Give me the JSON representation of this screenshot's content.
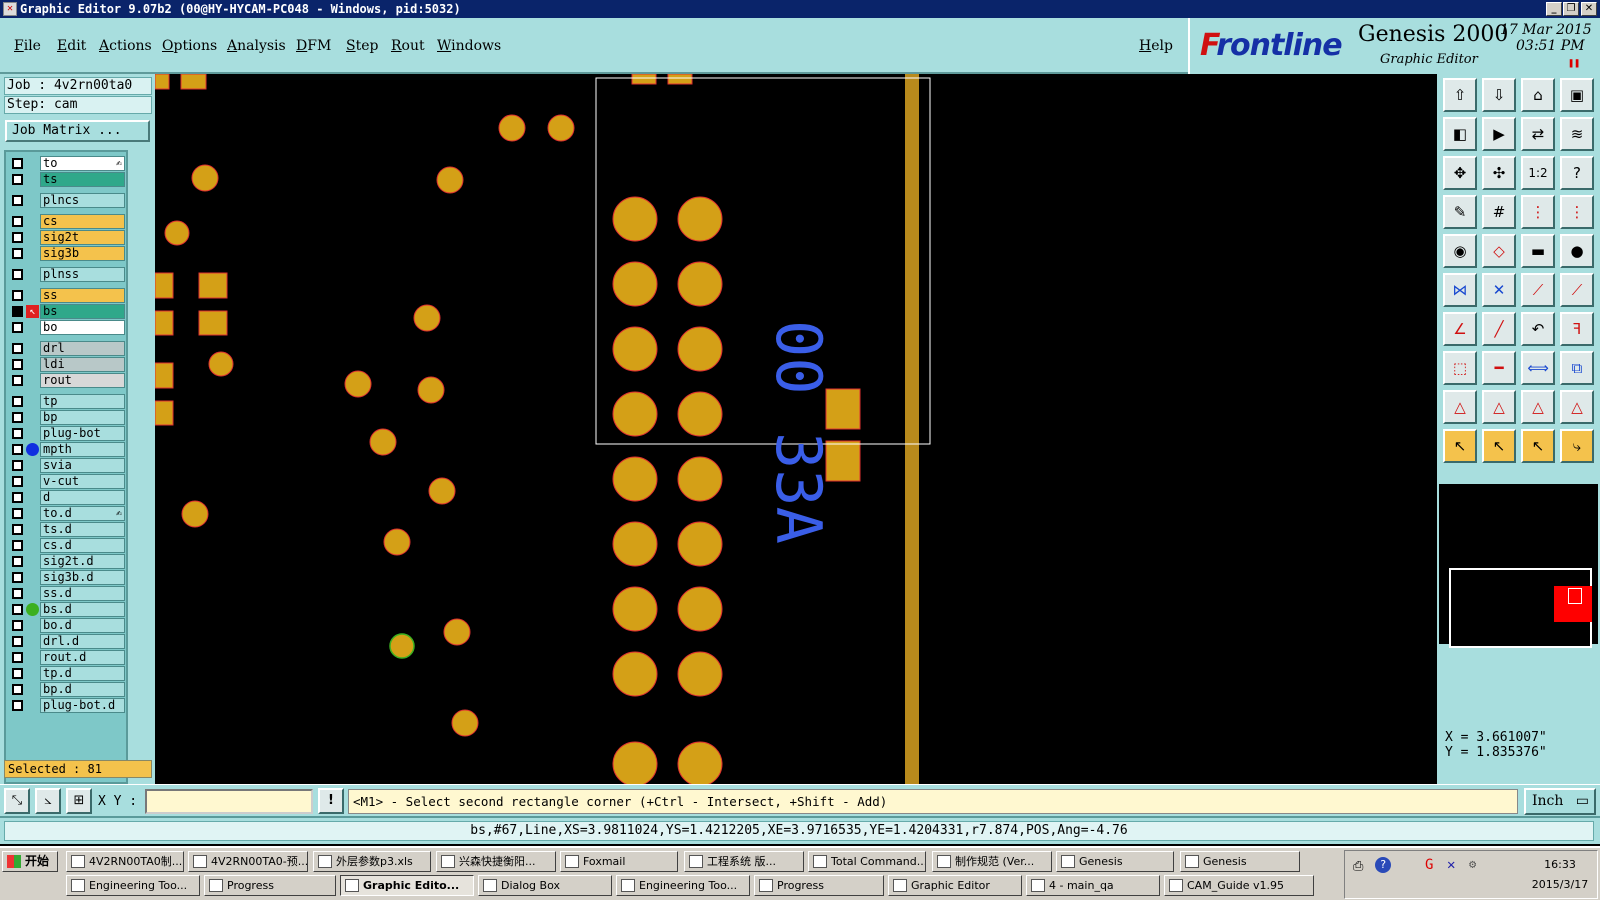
{
  "window": {
    "title": "Graphic Editor 9.07b2 (00@HY-HYCAM-PC048 - Windows, pid:5032)"
  },
  "menu": {
    "items": [
      "File",
      "Edit",
      "Actions",
      "Options",
      "Analysis",
      "DFM",
      "Step",
      "Rout",
      "Windows"
    ],
    "help": "Help"
  },
  "brand": {
    "logo_f": "F",
    "logo_rest": "rontline",
    "product": "Genesis 2000",
    "subtitle": "Graphic Editor",
    "date": "17 Mar 2015",
    "time": "03:51 PM"
  },
  "job": {
    "job_line": "Job : 4v2rn00ta0",
    "step_line": "Step: cam",
    "matrix_button": "Job Matrix ...",
    "selected": "Selected : 81"
  },
  "layers": [
    {
      "name": "to",
      "bg": "#ffffff",
      "flag": "✍"
    },
    {
      "name": "ts",
      "bg": "#2fa88a"
    },
    {
      "name": "plncs",
      "bg": "#a8dede"
    },
    {
      "name": "cs",
      "bg": "#f4c24c"
    },
    {
      "name": "sig2t",
      "bg": "#f4c24c"
    },
    {
      "name": "sig3b",
      "bg": "#f4c24c"
    },
    {
      "name": "plnss",
      "bg": "#a8dede"
    },
    {
      "name": "ss",
      "bg": "#f4c24c"
    },
    {
      "name": "bs",
      "bg": "#2fa88a",
      "selected": true,
      "cursor": true
    },
    {
      "name": "bo",
      "bg": "#ffffff"
    },
    {
      "name": "drl",
      "bg": "#b8c8c8"
    },
    {
      "name": "ldi",
      "bg": "#b8c8c8"
    },
    {
      "name": "rout",
      "bg": "#d8d8d8"
    },
    {
      "name": "tp",
      "bg": "#a8dede"
    },
    {
      "name": "bp",
      "bg": "#a8dede"
    },
    {
      "name": "plug-bot",
      "bg": "#a8dede"
    },
    {
      "name": "mpth",
      "bg": "#a8dede",
      "dot": "#1030e0"
    },
    {
      "name": "svia",
      "bg": "#a8dede"
    },
    {
      "name": "v-cut",
      "bg": "#a8dede"
    },
    {
      "name": "d",
      "bg": "#a8dede"
    },
    {
      "name": "to.d",
      "bg": "#a8dede",
      "flag": "✍"
    },
    {
      "name": "ts.d",
      "bg": "#a8dede"
    },
    {
      "name": "cs.d",
      "bg": "#a8dede"
    },
    {
      "name": "sig2t.d",
      "bg": "#a8dede"
    },
    {
      "name": "sig3b.d",
      "bg": "#a8dede"
    },
    {
      "name": "ss.d",
      "bg": "#a8dede"
    },
    {
      "name": "bs.d",
      "bg": "#a8dede",
      "dot": "#3cb020"
    },
    {
      "name": "bo.d",
      "bg": "#a8dede"
    },
    {
      "name": "drl.d",
      "bg": "#a8dede"
    },
    {
      "name": "rout.d",
      "bg": "#a8dede"
    },
    {
      "name": "tp.d",
      "bg": "#a8dede"
    },
    {
      "name": "bp.d",
      "bg": "#a8dede"
    },
    {
      "name": "plug-bot.d",
      "bg": "#a8dede"
    }
  ],
  "canvas": {
    "silk_text": "00 33A",
    "colors": {
      "pad": "#d4a017",
      "outline": "#e03030",
      "silk": "#3a5ee8",
      "trace": "#b88a1c"
    }
  },
  "toolbox": {
    "tools": [
      "load-icon",
      "save-icon",
      "home-icon",
      "frame-icon",
      "prev-icon",
      "next-icon",
      "swap-icon",
      "flip-icon",
      "fit-icon",
      "center-icon",
      "ratio-icon",
      "help-icon",
      "measure-icon",
      "grid-icon",
      "snap-icon",
      "snap2-icon",
      "pad-icon",
      "poly-icon",
      "ruler-icon",
      "dot-icon",
      "connect-icon",
      "cross-icon",
      "line-icon",
      "line2-icon",
      "angle-icon",
      "slash-icon",
      "undo-icon",
      "ff-icon",
      "move-icon",
      "minus-icon",
      "resize-icon",
      "group-icon",
      "tri1-icon",
      "tri2-icon",
      "tri3-icon",
      "tri4-icon",
      "select-icon",
      "select2-icon",
      "select3-icon",
      "route-icon"
    ],
    "ratio_label": "1:2"
  },
  "coords": {
    "x": "X = 3.661007\"",
    "y": "Y = 1.835376\""
  },
  "command": {
    "xy_label": "X Y :",
    "xy_value": "",
    "prompt": "<M1> - Select second rectangle corner (+Ctrl - Intersect, +Shift - Add)",
    "unit": "Inch"
  },
  "info": {
    "text": "bs,#67,Line,XS=3.9811024,YS=1.4212205,XE=3.9716535,YE=1.4204331,r7.874,POS,Ang=-4.76"
  },
  "taskbar": {
    "start": "开始",
    "row1": [
      "4V2RN00TA0制...",
      "4V2RN00TA0-预...",
      "外层参数p3.xls",
      "兴森快捷衡阳...",
      "Foxmail",
      "工程系统  版...",
      "Total Command...",
      "制作规范 (Ver...",
      "Genesis",
      "Genesis"
    ],
    "row2": [
      "Engineering Too...",
      "Progress",
      "Graphic Edito...",
      "Dialog Box",
      "Engineering Too...",
      "Progress",
      "Graphic Editor",
      "4 - main_qa",
      "CAM_Guide v1.95"
    ],
    "clock_time": "16:33",
    "clock_date": "2015/3/17"
  }
}
